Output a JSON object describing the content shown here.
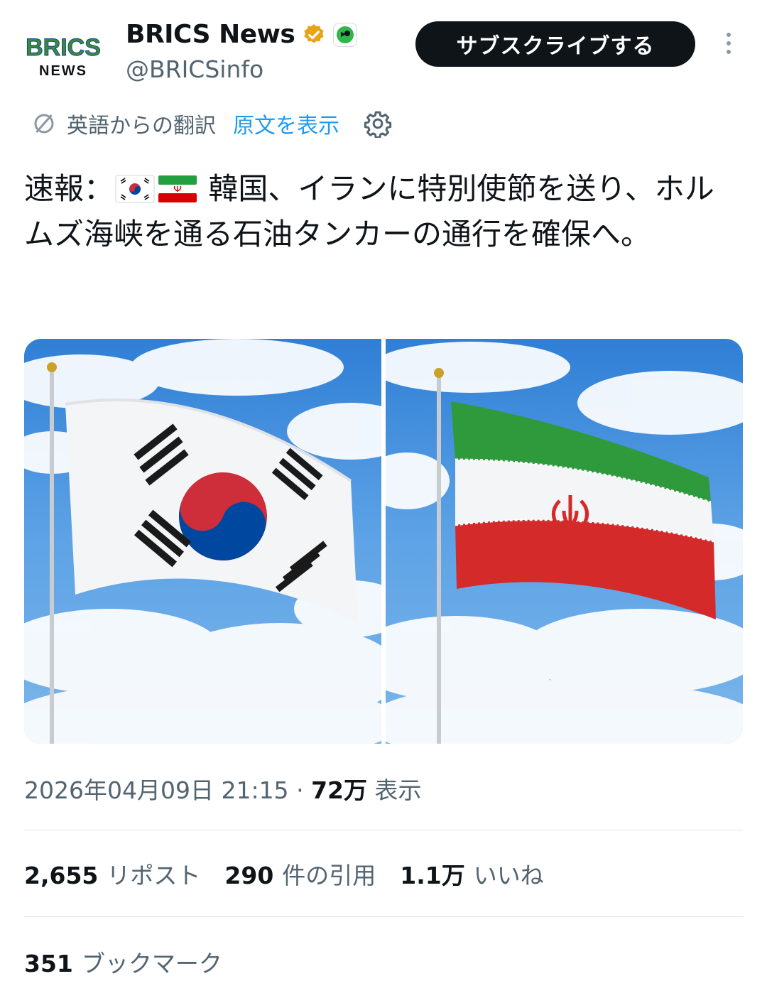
{
  "author": {
    "name": "BRICS News",
    "handle": "@BRICSinfo",
    "logo_text_top": "BRICS",
    "logo_text_bottom": "NEWS",
    "verified_color": "#e8a317"
  },
  "actions": {
    "subscribe_label": "サブスクライブする"
  },
  "translation": {
    "label": "英語からの翻訳",
    "show_original": "原文を表示"
  },
  "tweet": {
    "prefix": "速報：",
    "text": "韓国、イランに特別使節を送り、ホルムズ海峡を通る石油タンカーの通行を確保へ。"
  },
  "media": [
    {
      "subject": "South Korea flag on pole against cloudy sky"
    },
    {
      "subject": "Iran flag on pole against cloudy sky"
    }
  ],
  "meta": {
    "timestamp": "2026年04月09日 21:15",
    "separator": "·",
    "views_count": "72万",
    "views_label": "表示"
  },
  "stats": {
    "reposts_count": "2,655",
    "reposts_label": "リポスト",
    "quotes_count": "290",
    "quotes_label": "件の引用",
    "likes_count": "1.1万",
    "likes_label": "いいね",
    "bookmarks_count": "351",
    "bookmarks_label": "ブックマーク"
  },
  "colors": {
    "accent": "#1d9bf0",
    "text_primary": "#0f1419",
    "text_secondary": "#536471"
  }
}
